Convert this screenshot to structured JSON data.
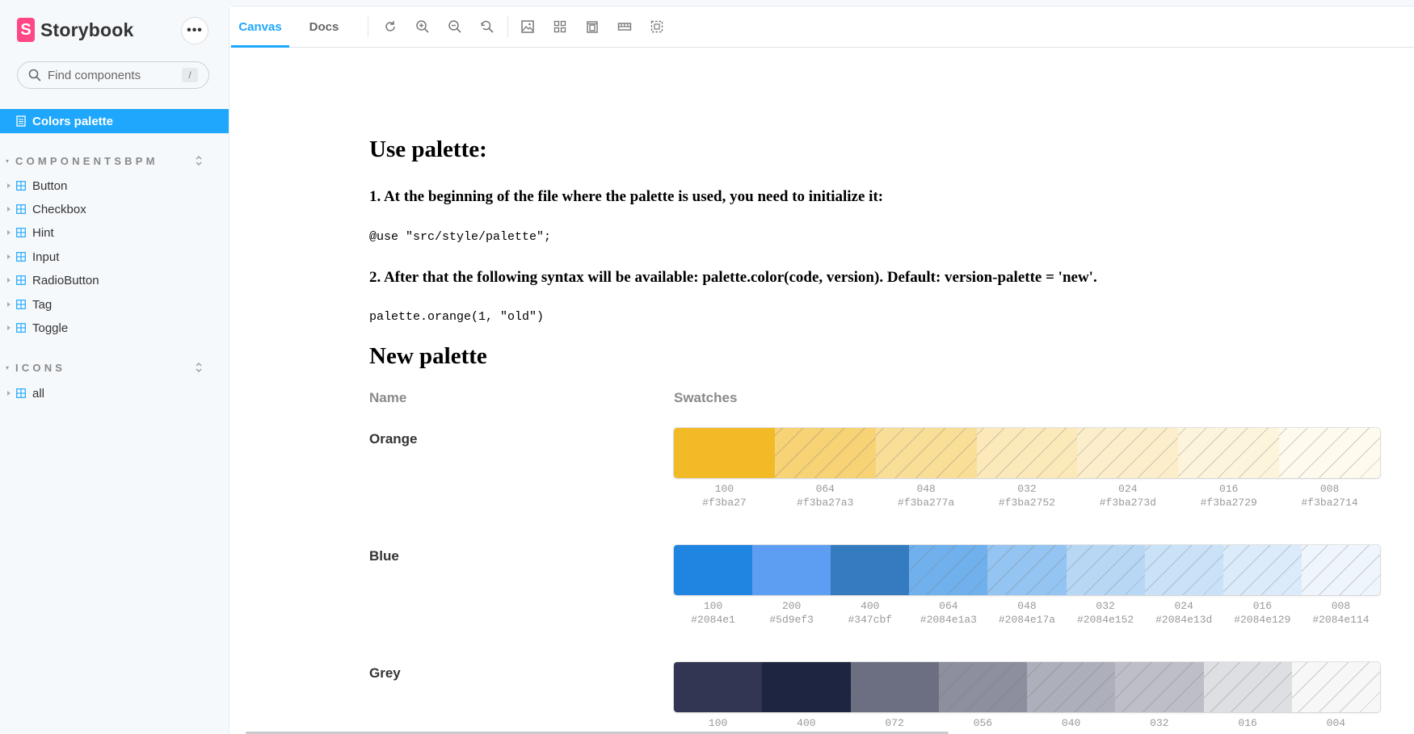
{
  "brand": {
    "name": "Storybook",
    "logo_letter": "S"
  },
  "sidebar": {
    "search_placeholder": "Find components",
    "search_shortcut": "/",
    "active_item": "Colors palette",
    "groups": [
      {
        "title": "COMPONENTSBPM",
        "items": [
          "Button",
          "Checkbox",
          "Hint",
          "Input",
          "RadioButton",
          "Tag",
          "Toggle"
        ]
      },
      {
        "title": "ICONS",
        "items": [
          "all"
        ]
      }
    ]
  },
  "toolbar": {
    "tabs": [
      "Canvas",
      "Docs"
    ],
    "active_tab": "Canvas",
    "tools": [
      "reload-icon",
      "zoom-in-icon",
      "zoom-out-icon",
      "zoom-reset-icon",
      "background-icon",
      "grid-icon",
      "viewport-icon",
      "measure-icon",
      "outline-icon"
    ]
  },
  "doc": {
    "heading_use": "Use palette:",
    "step1": "1. At the beginning of the file where the palette is used, you need to initialize it:",
    "code1": "@use \"src/style/palette\";",
    "step2": "2. After that the following syntax will be available: palette.color(code, version). Default: version-palette = 'new'.",
    "code2": "palette.orange(1, \"old\")",
    "heading_new": "New palette",
    "col_name": "Name",
    "col_swatches": "Swatches",
    "palettes": [
      {
        "name": "Orange",
        "swatches": [
          {
            "code": "100",
            "value": "#f3ba27",
            "color": "#f3ba27"
          },
          {
            "code": "064",
            "value": "#f3ba27a3",
            "color": "#f3ba27a3"
          },
          {
            "code": "048",
            "value": "#f3ba277a",
            "color": "#f3ba277a"
          },
          {
            "code": "032",
            "value": "#f3ba2752",
            "color": "#f3ba2752"
          },
          {
            "code": "024",
            "value": "#f3ba273d",
            "color": "#f3ba273d"
          },
          {
            "code": "016",
            "value": "#f3ba2729",
            "color": "#f3ba2729"
          },
          {
            "code": "008",
            "value": "#f3ba2714",
            "color": "#f3ba2714"
          }
        ]
      },
      {
        "name": "Blue",
        "swatches": [
          {
            "code": "100",
            "value": "#2084e1",
            "color": "#2084e1"
          },
          {
            "code": "200",
            "value": "#5d9ef3",
            "color": "#5d9ef3"
          },
          {
            "code": "400",
            "value": "#347cbf",
            "color": "#347cbf"
          },
          {
            "code": "064",
            "value": "#2084e1a3",
            "color": "#2084e1a3"
          },
          {
            "code": "048",
            "value": "#2084e17a",
            "color": "#2084e17a"
          },
          {
            "code": "032",
            "value": "#2084e152",
            "color": "#2084e152"
          },
          {
            "code": "024",
            "value": "#2084e13d",
            "color": "#2084e13d"
          },
          {
            "code": "016",
            "value": "#2084e129",
            "color": "#2084e129"
          },
          {
            "code": "008",
            "value": "#2084e114",
            "color": "#2084e114"
          }
        ]
      },
      {
        "name": "Grey",
        "swatches": [
          {
            "code": "100",
            "value": "",
            "color": "#333652"
          },
          {
            "code": "400",
            "value": "",
            "color": "#1e2540"
          },
          {
            "code": "072",
            "value": "",
            "color": "#333652b8"
          },
          {
            "code": "056",
            "value": "",
            "color": "#3336528f"
          },
          {
            "code": "040",
            "value": "",
            "color": "#33365266"
          },
          {
            "code": "032",
            "value": "",
            "color": "#33365252"
          },
          {
            "code": "016",
            "value": "",
            "color": "#33365229"
          },
          {
            "code": "004",
            "value": "",
            "color": "#3336520a"
          }
        ]
      }
    ]
  },
  "colors": {
    "accent": "#1ea7fd",
    "brand": "#ff4785"
  }
}
